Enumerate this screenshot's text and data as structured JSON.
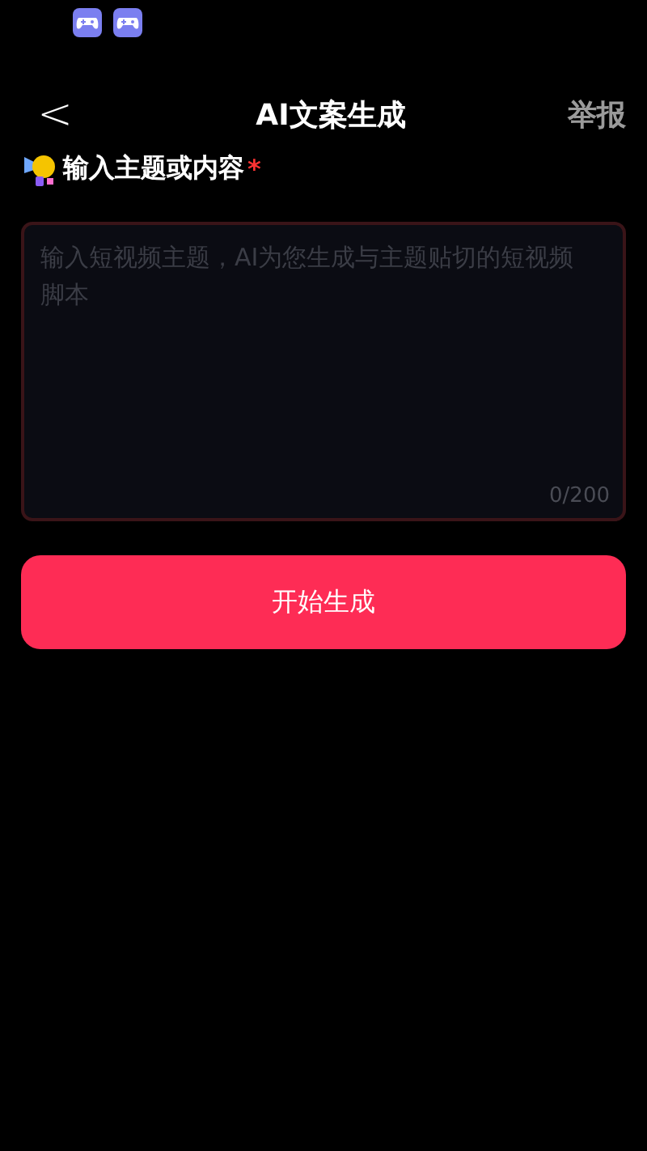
{
  "status_bar": {
    "notifications": [
      {
        "kind": "gamepad"
      },
      {
        "kind": "gamepad"
      }
    ]
  },
  "header": {
    "back": "<",
    "title": "AI文案生成",
    "action": "举报"
  },
  "form": {
    "label": "输入主题或内容",
    "required": true,
    "required_mark": "*",
    "placeholder": "输入短视频主题，AI为您生成与主题贴切的短视频脚本",
    "counter": "0/200",
    "button": "开始生成"
  }
}
